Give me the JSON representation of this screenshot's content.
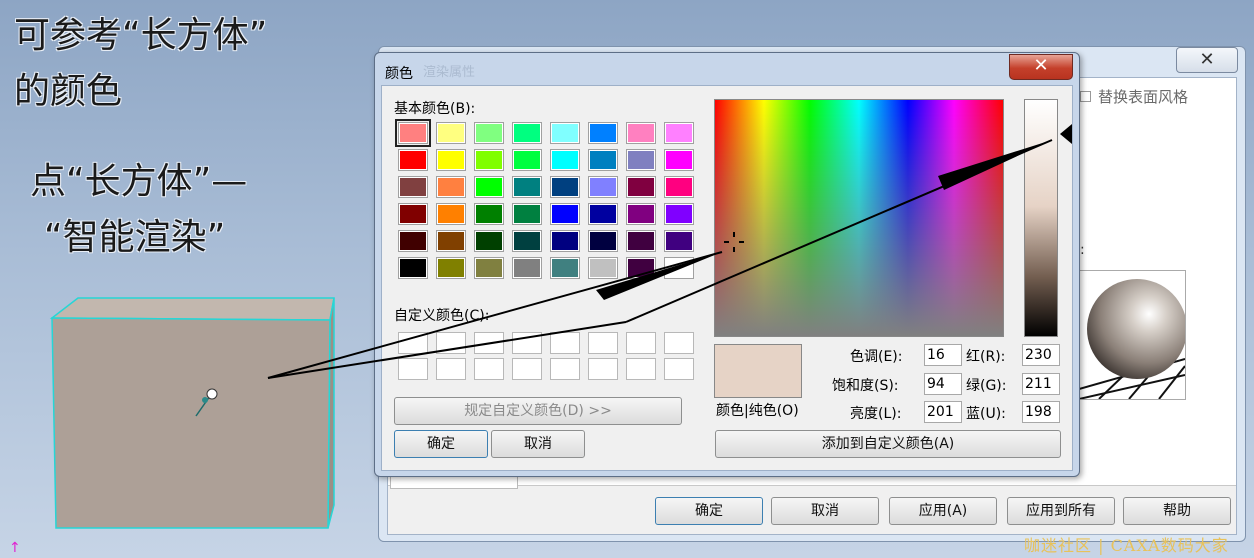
{
  "annotations": {
    "line1": "可参考“长方体”",
    "line2": "的颜色",
    "line3": "点“长方体”—",
    "line4": "“智能渲染”"
  },
  "background_dialog": {
    "close_glyph": "✕",
    "replace_style_label": "替换表面风格",
    "colon": ":",
    "buttons": {
      "ok": "确定",
      "cancel": "取消",
      "apply": "应用(A)",
      "apply_all": "应用到所有",
      "help": "帮助"
    }
  },
  "color_dialog": {
    "title": "颜色",
    "ghost_title": "渲染属性",
    "close_glyph": "✕",
    "basic_colors_label": "基本颜色(B):",
    "custom_colors_label": "自定义颜色(C):",
    "define_custom_button": "规定自定义颜色(D) >>",
    "ok_button": "确定",
    "cancel_button": "取消",
    "color_solid_label": "颜色|纯色(O)",
    "hue_label": "色调(E):",
    "sat_label": "饱和度(S):",
    "lum_label": "亮度(L):",
    "red_label": "红(R):",
    "green_label": "绿(G):",
    "blue_label": "蓝(U):",
    "hue_value": "16",
    "sat_value": "94",
    "lum_value": "201",
    "red_value": "230",
    "green_value": "211",
    "blue_value": "198",
    "add_custom_button": "添加到自定义颜色(A)",
    "current_color": "#e6d3c6",
    "basic_colors": [
      [
        "#ff8080",
        "#ffff80",
        "#80ff80",
        "#00ff80",
        "#80ffff",
        "#0080ff",
        "#ff80c0",
        "#ff80ff"
      ],
      [
        "#ff0000",
        "#ffff00",
        "#80ff00",
        "#00ff40",
        "#00ffff",
        "#0080c0",
        "#8080c0",
        "#ff00ff"
      ],
      [
        "#804040",
        "#ff8040",
        "#00ff00",
        "#008080",
        "#004080",
        "#8080ff",
        "#800040",
        "#ff0080"
      ],
      [
        "#800000",
        "#ff8000",
        "#008000",
        "#008040",
        "#0000ff",
        "#0000a0",
        "#800080",
        "#8000ff"
      ],
      [
        "#400000",
        "#804000",
        "#004000",
        "#004040",
        "#000080",
        "#000040",
        "#400040",
        "#400080"
      ],
      [
        "#000000",
        "#808000",
        "#808040",
        "#808080",
        "#408080",
        "#c0c0c0",
        "#400040",
        "#ffffff"
      ]
    ]
  },
  "watermark": "咖迷社区 | CAXA数码大家",
  "colors": {
    "box_face": "#ada097",
    "box_edge": "#26d6d6"
  }
}
